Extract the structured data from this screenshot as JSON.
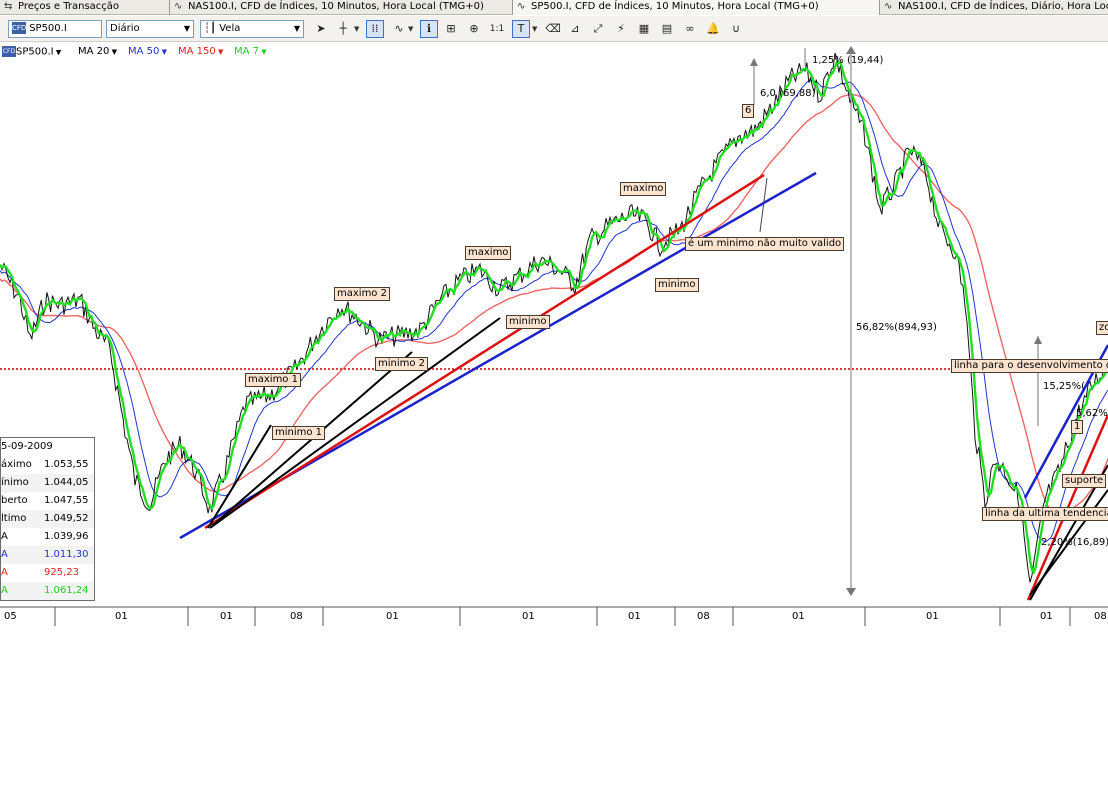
{
  "tabs": [
    {
      "label": "Preços e Transacção"
    },
    {
      "label": "NAS100.I, CFD de Índices, 10 Minutos, Hora Local (TMG+0)"
    },
    {
      "label": "SP500.I, CFD de Índices, 10 Minutos, Hora Local (TMG+0)"
    },
    {
      "label": "NAS100.I, CFD de Índices, Diário, Hora Local (TMG+0)"
    }
  ],
  "toolbar": {
    "symbol": "SP500.I",
    "period": "Diário",
    "chart_type": "Vela",
    "icons": [
      "cursor-icon",
      "crosshair-icon",
      "grid-icon",
      "wave-icon",
      "info-icon",
      "zoom-box-icon",
      "zoom-in-icon",
      "one-to-one-icon",
      "text-tool-icon",
      "eraser-icon",
      "measure-icon",
      "fibonacci-icon",
      "pattern-icon",
      "export-icon",
      "compare-icon",
      "link-icon",
      "alert-bell-icon",
      "magnet-icon"
    ]
  },
  "legend": {
    "symbol": "SP500.I",
    "indicators": [
      {
        "label": "MA 20",
        "color": "#000000"
      },
      {
        "label": "MA 50",
        "color": "#2233cc"
      },
      {
        "label": "MA 150",
        "color": "#dd2222"
      },
      {
        "label": "MA 7",
        "color": "#22cc22"
      }
    ]
  },
  "infobox": {
    "date": "5-09-2009",
    "rows": [
      {
        "label": "áximo",
        "value": "1.053,55",
        "color": "#000000"
      },
      {
        "label": "ínimo",
        "value": "1.044,05",
        "color": "#000000"
      },
      {
        "label": "berto",
        "value": "1.047,55",
        "color": "#000000"
      },
      {
        "label": "ltimo",
        "value": "1.049,52",
        "color": "#000000"
      },
      {
        "label": "A",
        "value": "1.039,96",
        "color": "#000000"
      },
      {
        "label": "A",
        "value": "1.011,30",
        "color": "#2233cc"
      },
      {
        "label": "A",
        "value": "925,23",
        "color": "#dd2222"
      },
      {
        "label": "A",
        "value": "1.061,24",
        "color": "#22cc22"
      }
    ]
  },
  "annotations": {
    "maximo": "maximo",
    "maximo2": "maximo 2",
    "maximo1": "maximo 1",
    "maximo_top": "maximo",
    "minimo1": "minimo 1",
    "minimo2": "minimo 2",
    "minimo_a": "minimo",
    "minimo_b": "minimo",
    "nao_valido": "é um minimo não muito valido",
    "six": "6",
    "pct_top": "1,25% (19,44)",
    "pct_two": "6,0 (69,88)",
    "pct_big": "56,82%(894,93)",
    "linha_desenv": "linha para o desenvolvimento d",
    "pct_1525": "15,25%(",
    "pct_5": "5,62%",
    "pct_220": "2,20%(16,89)",
    "linha_ult": "linha da ultima tendencia",
    "suporte": "suporte",
    "zo": "zo",
    "one": "1"
  },
  "x_axis": [
    "05",
    "01",
    "01",
    "08",
    "01",
    "01",
    "01",
    "08",
    "01",
    "01",
    "01",
    "08"
  ],
  "colors": {
    "ma20": "#000000",
    "ma50": "#2233cc",
    "ma150": "#dd2222",
    "ma7": "#22cc22",
    "trend_red": "#dd1111",
    "trend_blue": "#1a22cc",
    "support_line": "#cc0000"
  }
}
